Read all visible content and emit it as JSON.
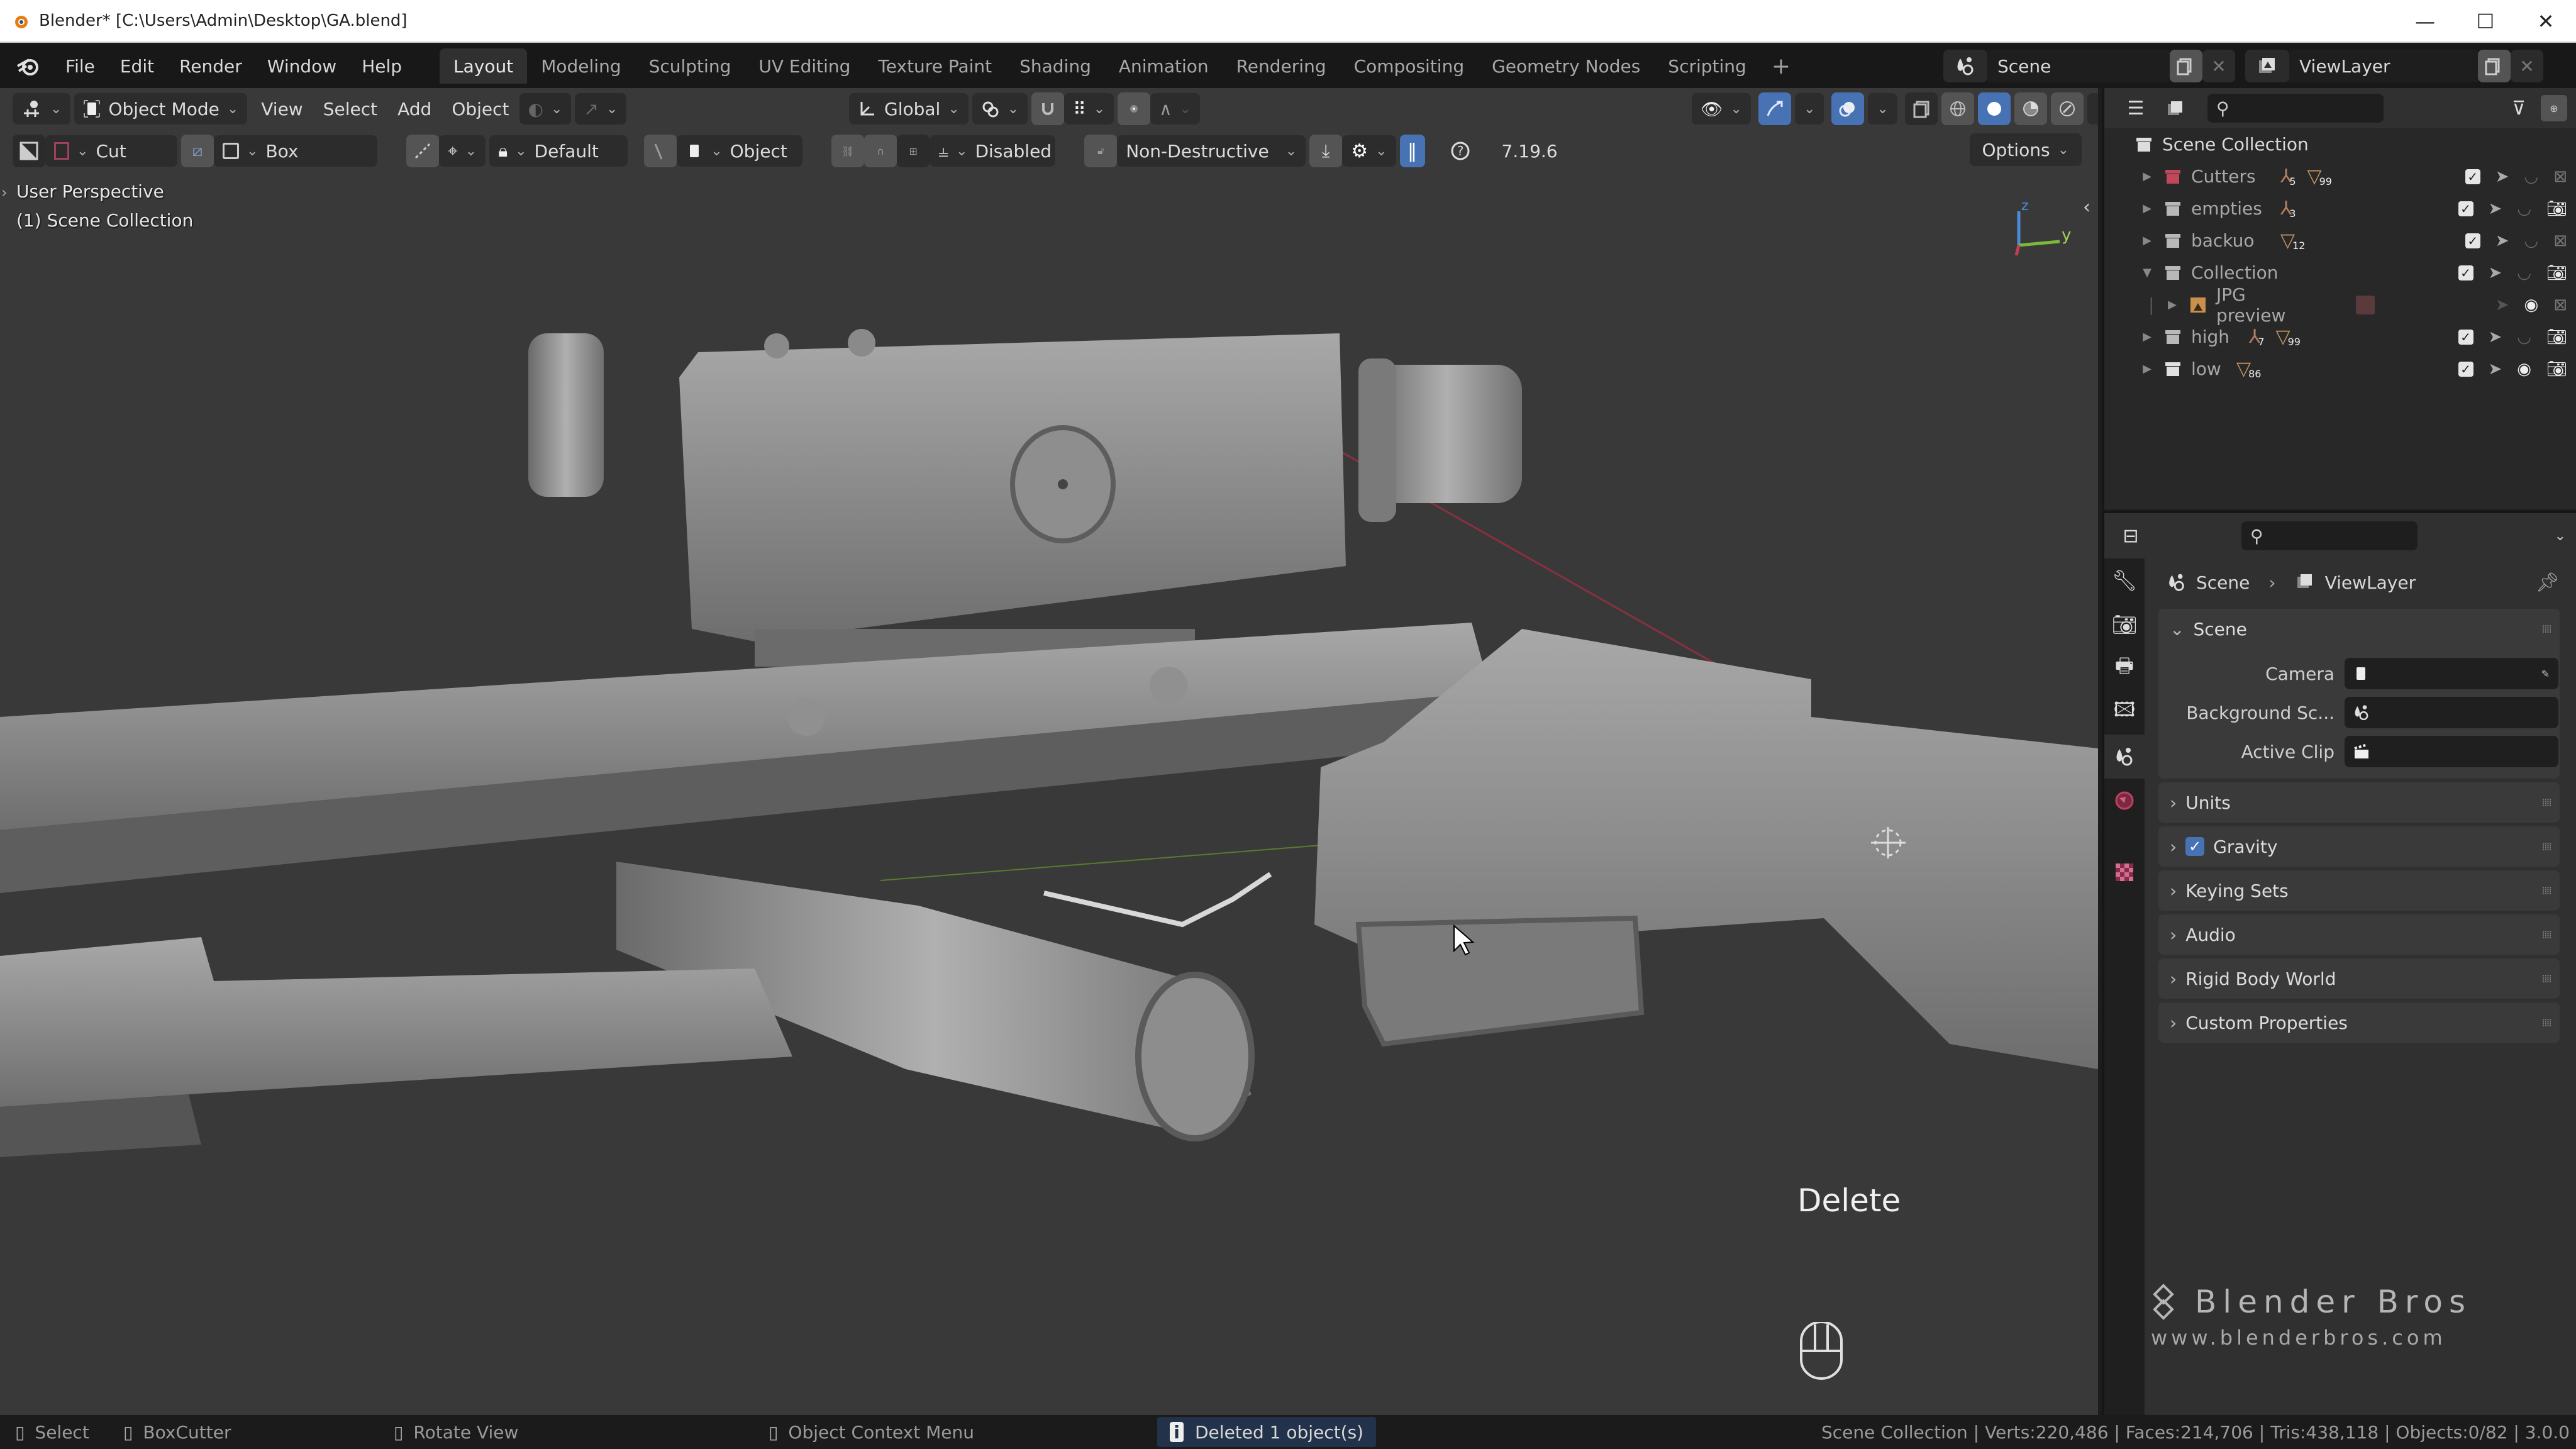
{
  "window": {
    "title": "Blender* [C:\\Users\\Admin\\Desktop\\GA.blend]",
    "controls": {
      "minimize": "—",
      "maximize": "☐",
      "close": "✕"
    }
  },
  "menu": {
    "items": [
      "File",
      "Edit",
      "Render",
      "Window",
      "Help"
    ]
  },
  "workspaces": {
    "tabs": [
      "Layout",
      "Modeling",
      "Sculpting",
      "UV Editing",
      "Texture Paint",
      "Shading",
      "Animation",
      "Rendering",
      "Compositing",
      "Geometry Nodes",
      "Scripting"
    ],
    "active": "Layout",
    "add_label": "+"
  },
  "scene_selector": {
    "scene": "Scene",
    "view_layer": "ViewLayer"
  },
  "viewport_header": {
    "mode": "Object Mode",
    "menus": [
      "View",
      "Select",
      "Add",
      "Object"
    ],
    "transform_orientation": "Global",
    "shading_active": "solid"
  },
  "tool_settings": {
    "operation": "Cut",
    "shape": "Box",
    "mode": "Default",
    "target": "Object",
    "snap": "Disabled",
    "behavior": "Non-Destructive",
    "version": "7.19.6",
    "options_label": "Options"
  },
  "viewport": {
    "view_name": "User Perspective",
    "collection_label": "(1) Scene Collection",
    "key_hint": "Delete",
    "gizmo": {
      "z": "z",
      "y": "y"
    }
  },
  "outliner": {
    "root": "Scene Collection",
    "rows": [
      {
        "name": "Cutters",
        "expanded": false,
        "color": "#c0485a",
        "empties": "5",
        "meshes": "99",
        "visible": true,
        "render": false,
        "indent": 0
      },
      {
        "name": "empties",
        "expanded": false,
        "color": "#b8b8b8",
        "empties": "3",
        "meshes": "",
        "visible": true,
        "render": true,
        "indent": 0
      },
      {
        "name": "backuo",
        "expanded": false,
        "color": "#b8b8b8",
        "empties": "",
        "meshes": "12",
        "visible": true,
        "render": false,
        "indent": 0
      },
      {
        "name": "Collection",
        "expanded": true,
        "color": "#b8b8b8",
        "empties": "",
        "meshes": "",
        "visible": true,
        "render": true,
        "indent": 0
      },
      {
        "name": "JPG preview",
        "expanded": false,
        "color": "#c8904a",
        "empties": "",
        "meshes": "",
        "visible": true,
        "render": false,
        "indent": 1
      },
      {
        "name": "high",
        "expanded": false,
        "color": "#b8b8b8",
        "empties": "7",
        "meshes": "99",
        "visible": true,
        "render": true,
        "indent": 0
      },
      {
        "name": "low",
        "expanded": false,
        "color": "#e0e0e0",
        "empties": "",
        "meshes": "86",
        "visible": true,
        "render": true,
        "indent": 0
      }
    ]
  },
  "properties": {
    "breadcrumb": [
      "Scene",
      "ViewLayer"
    ],
    "panel_title": "Scene",
    "fields": [
      {
        "label": "Camera",
        "value": "",
        "icon": "camera"
      },
      {
        "label": "Background Sc...",
        "value": "",
        "icon": "scene"
      },
      {
        "label": "Active Clip",
        "value": "",
        "icon": "clip"
      }
    ],
    "subpanels": [
      {
        "label": "Units",
        "checkbox": false
      },
      {
        "label": "Gravity",
        "checkbox": true,
        "checked": true
      },
      {
        "label": "Keying Sets",
        "checkbox": false
      },
      {
        "label": "Audio",
        "checkbox": false
      },
      {
        "label": "Rigid Body World",
        "checkbox": false
      },
      {
        "label": "Custom Properties",
        "checkbox": false
      }
    ]
  },
  "watermark": {
    "title": "Blender Bros",
    "url": "www.blenderbros.com"
  },
  "statusbar": {
    "hints": [
      "Select",
      "BoxCutter",
      "Rotate View",
      "Object Context Menu"
    ],
    "report": "Deleted 1 object(s)",
    "stats": "Scene Collection | Verts:220,486 | Faces:214,706 | Tris:438,118 | Objects:0/82 | 3.0.0"
  },
  "colors": {
    "accent_blue": "#4772b3",
    "x_axis": "#c04050",
    "y_axis": "#7cb83a",
    "z_axis": "#4a8ad8"
  }
}
